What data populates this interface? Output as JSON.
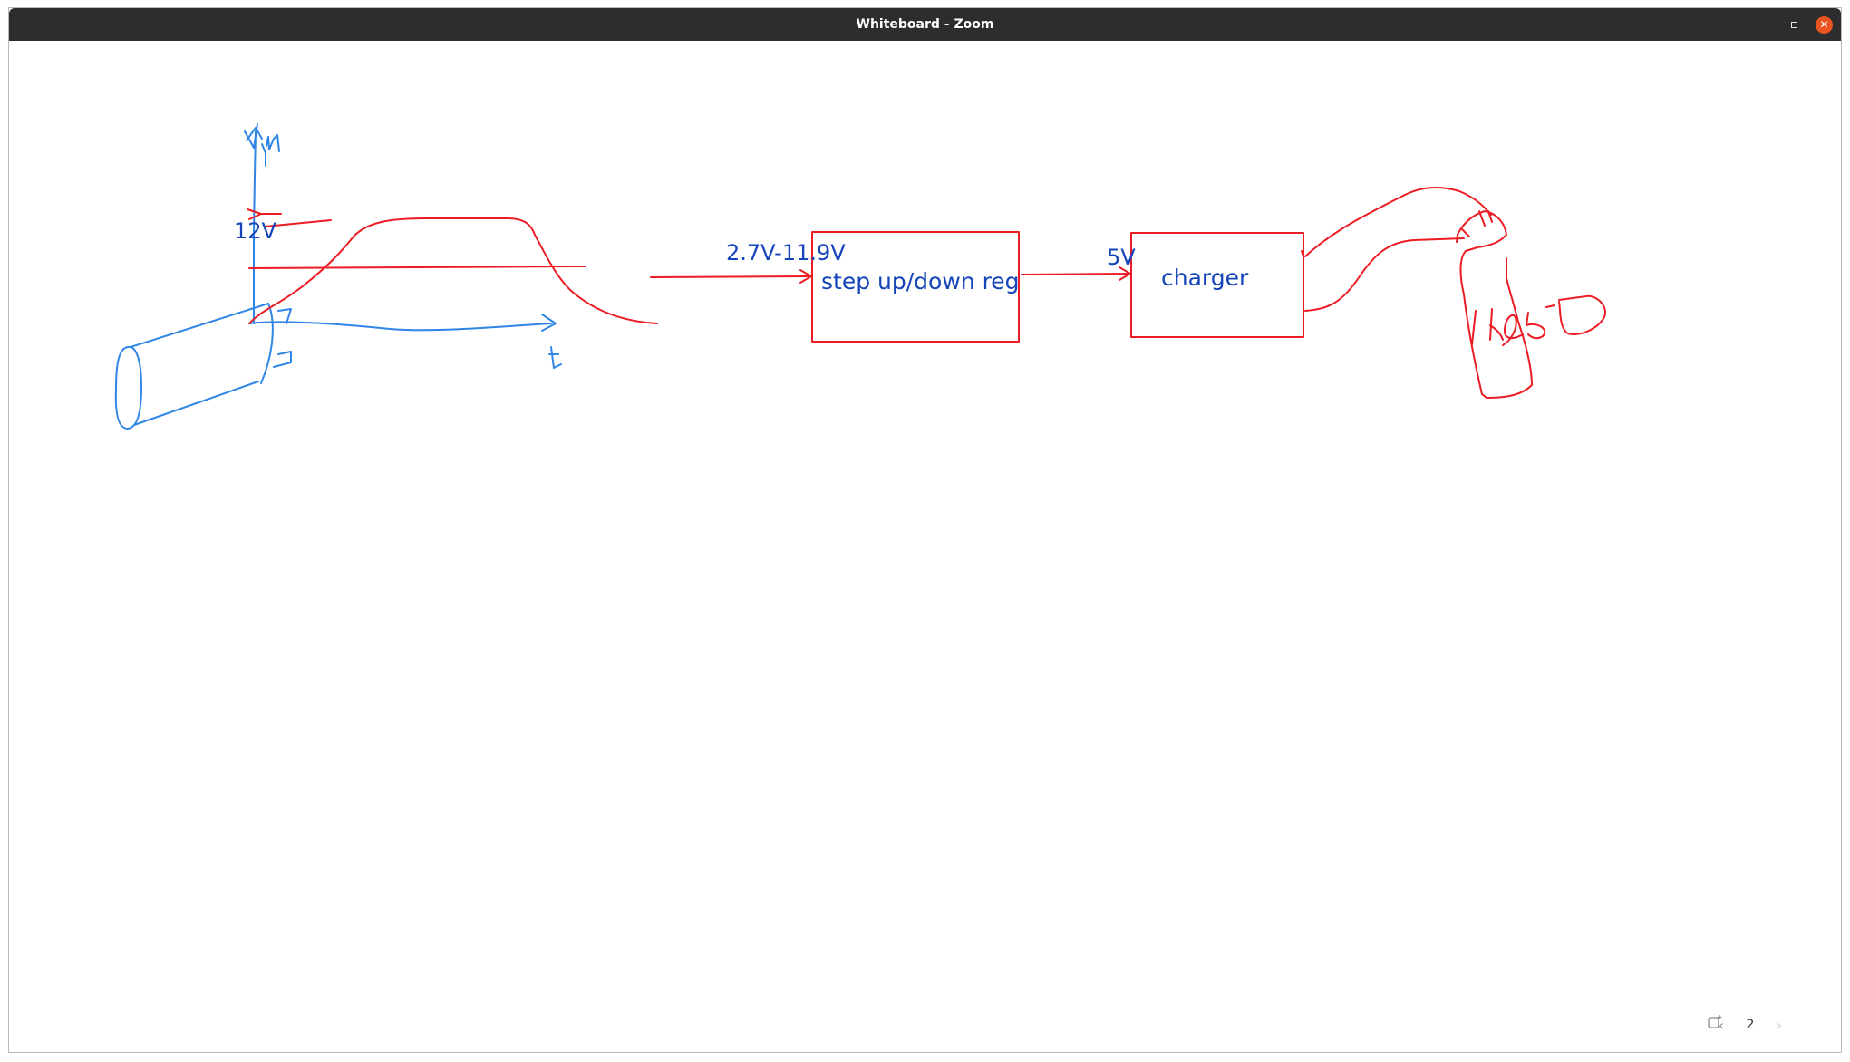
{
  "window": {
    "title": "Whiteboard - Zoom",
    "close_glyph": "✕",
    "colors": {
      "titlebar": "#2d2d2d",
      "close": "#e95420"
    }
  },
  "whiteboard": {
    "annotations": {
      "y_axis_label": "Vdyn",
      "voltage_12v": "12V",
      "t_axis_label": "t",
      "range_label": "2.7V-11.9V",
      "regulator_label": "step up/down reg",
      "five_volt_label": "5V",
      "charger_label": "charger",
      "battery_label": "18650"
    },
    "colors": {
      "ink_red": "#ec1c24",
      "ink_blue": "#2f86e6",
      "text_blue": "#1545b8"
    }
  },
  "pager": {
    "prev_icon": "chevron-left-icon",
    "page_number": "2",
    "next_icon": "chevron-right-icon",
    "add_page_icon": "add-page-icon"
  }
}
